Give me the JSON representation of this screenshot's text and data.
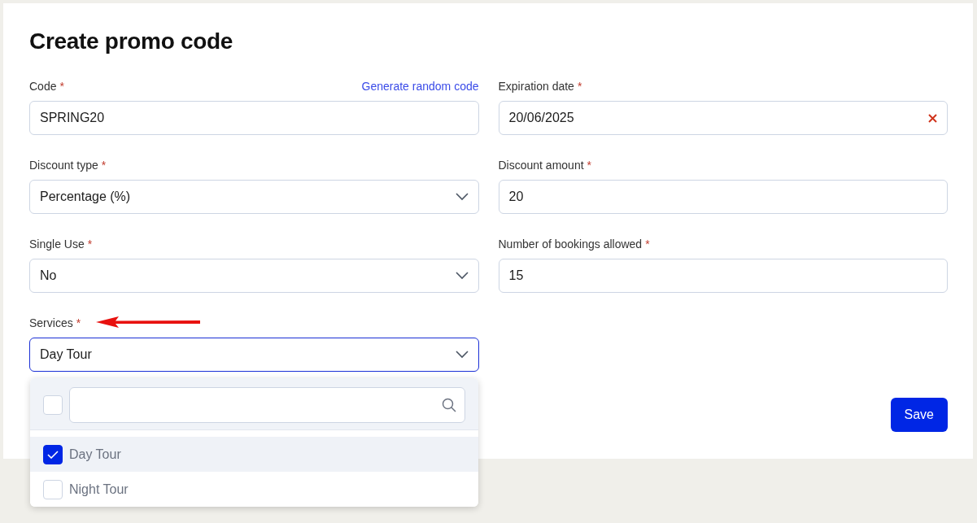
{
  "title": "Create promo code",
  "fields": [
    {
      "kind": "text",
      "label": "Code",
      "required_mark": "*",
      "value": "SPRING20",
      "link": "Generate random code",
      "focused": false
    },
    {
      "kind": "date",
      "label": "Expiration date",
      "required_mark": "*",
      "value": "20/06/2025",
      "clearable": true,
      "focused": false
    },
    {
      "kind": "select",
      "label": "Discount type",
      "required_mark": "*",
      "value": "Percentage (%)",
      "focused": false
    },
    {
      "kind": "text",
      "label": "Discount amount",
      "required_mark": "*",
      "value": "20",
      "focused": false
    },
    {
      "kind": "select",
      "label": "Single Use",
      "required_mark": "*",
      "value": "No",
      "focused": false
    },
    {
      "kind": "text",
      "label": "Number of bookings allowed",
      "required_mark": "*",
      "value": "15",
      "focused": false
    },
    {
      "kind": "select",
      "label": "Services",
      "required_mark": "*",
      "value": "Day Tour",
      "focused": true,
      "expanded": true
    }
  ],
  "dropdown": {
    "select_all": {
      "checked": false
    },
    "options": [
      {
        "label": "Day Tour",
        "checked": true,
        "highlighted": true
      },
      {
        "label": "Night Tour",
        "checked": false,
        "highlighted": false
      }
    ]
  },
  "buttons": [
    "Save"
  ]
}
